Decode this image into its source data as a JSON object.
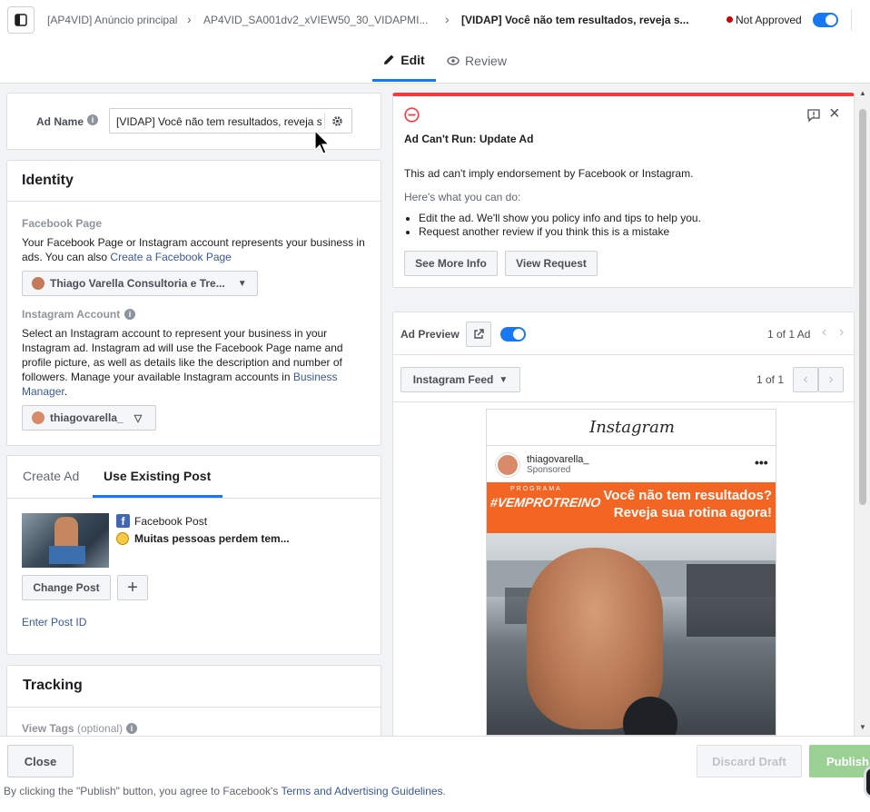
{
  "header": {
    "breadcrumbs": [
      "[AP4VID] Anúncio principal",
      "AP4VID_SA001dv2_xVIEW50_30_VIDAPMI...",
      "[VIDAP] Você não tem resultados, reveja s..."
    ],
    "status": "Not Approved",
    "status_color": "#cc0000",
    "toggle_on": true
  },
  "tabs": {
    "edit": "Edit",
    "review": "Review"
  },
  "ad_name": {
    "label": "Ad Name",
    "value": "[VIDAP] Você não tem resultados, reveja s"
  },
  "identity": {
    "title": "Identity",
    "facebook_page_label": "Facebook Page",
    "facebook_page_desc": "Your Facebook Page or Instagram account represents your business in ads. You can also",
    "facebook_page_link": "Create a Facebook Page",
    "page_selected": "Thiago Varella Consultoria e Tre...",
    "instagram_label": "Instagram Account",
    "instagram_desc": "Select an Instagram account to represent your business in your Instagram ad. Instagram ad will use the Facebook Page name and profile picture, as well as details like the description and number of followers. Manage your available Instagram accounts in",
    "instagram_link": "Business Manager",
    "instagram_selected": "thiagovarella_"
  },
  "creative": {
    "tab_create": "Create Ad",
    "tab_existing": "Use Existing Post",
    "post_type": "Facebook Post",
    "post_text": "Muitas pessoas perdem tem...",
    "change_post": "Change Post",
    "enter_post_id": "Enter Post ID"
  },
  "tracking": {
    "title": "Tracking",
    "view_tags": "View Tags",
    "optional": "(optional)"
  },
  "alert": {
    "title": "Ad Can't Run: Update Ad",
    "message": "This ad can't imply endorsement by Facebook or Instagram.",
    "subtitle": "Here's what you can do:",
    "bullets": [
      "Edit the ad. We'll show you policy info and tips to help you.",
      "Request another review if you think this is a mistake"
    ],
    "see_more": "See More Info",
    "view_request": "View Request",
    "accent_color": "#fa383e"
  },
  "preview": {
    "title": "Ad Preview",
    "counter": "1 of 1 Ad",
    "placement": "Instagram Feed",
    "page_counter": "1 of 1",
    "ig_logo": "Instagram",
    "ig_account": "thiagovarella_",
    "ig_sponsored": "Sponsored",
    "banner_small": "PROGRAMA",
    "banner_brand": "#VEMPROTREINO",
    "banner_line1": "Você não tem resultados?",
    "banner_line2": "Reveja sua rotina agora!",
    "banner_color": "#f26522"
  },
  "footer": {
    "close": "Close",
    "discard": "Discard Draft",
    "publish": "Publish",
    "legal_prefix": "By clicking the \"Publish\" button, you agree to Facebook's",
    "legal_link": "Terms and Advertising Guidelines",
    "legal_suffix": "."
  }
}
